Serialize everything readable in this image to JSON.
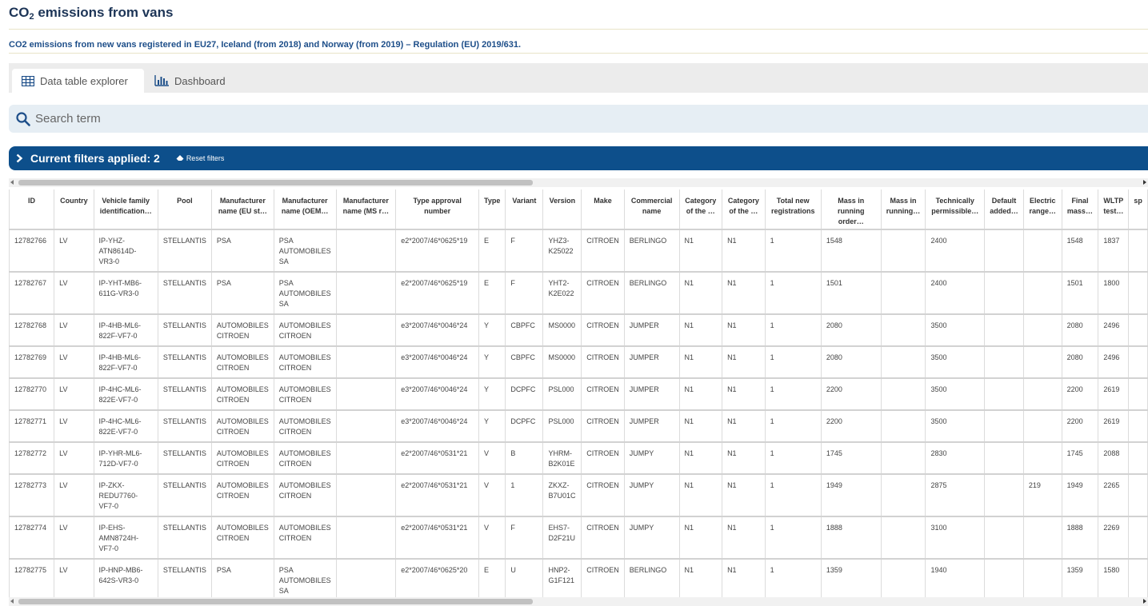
{
  "header": {
    "title_prefix": "CO",
    "title_sub": "2",
    "title_suffix": " emissions from vans",
    "subtitle": "CO2 emissions from new vans registered in EU27, Iceland (from 2018) and Norway (from 2019) – Regulation (EU) 2019/631."
  },
  "tabs": [
    {
      "label": "Data table explorer",
      "icon": "table-grid-icon",
      "active": true
    },
    {
      "label": "Dashboard",
      "icon": "bar-chart-icon",
      "active": false
    }
  ],
  "search": {
    "placeholder": "Search term"
  },
  "filters": {
    "label": "Current filters applied: 2",
    "reset_label": "Reset filters"
  },
  "colors": {
    "primary": "#0d4f8b",
    "search_bg": "#e6eef4",
    "tabbar_bg": "#ececec",
    "title": "#1d3557"
  },
  "table": {
    "columns": [
      "ID",
      "Country",
      "Vehicle family identification…",
      "Pool",
      "Manufacturer name (EU st…",
      "Manufacturer name (OEM…",
      "Manufacturer name (MS r…",
      "Type approval number",
      "Type",
      "Variant",
      "Version",
      "Make",
      "Commercial name",
      "Category of the …",
      "Category of the …",
      "Total new registrations",
      "Mass in running order…",
      "Mass in running…",
      "Technically permissible…",
      "Default added…",
      "Electric range…",
      "Final mass…",
      "WLTP test…",
      "sp"
    ],
    "rows": [
      [
        "12782766",
        "LV",
        "IP-YHZ-ATN8614D-VR3-0",
        "STELLANTIS",
        "PSA",
        "PSA AUTOMOBILES SA",
        "",
        "e2*2007/46*0625*19",
        "E",
        "F",
        "YHZ3-K25022",
        "CITROEN",
        "BERLINGO",
        "N1",
        "N1",
        "1",
        "1548",
        "",
        "2400",
        "",
        "",
        "1548",
        "1837",
        ""
      ],
      [
        "12782767",
        "LV",
        "IP-YHT-MB6-611G-VR3-0",
        "STELLANTIS",
        "PSA",
        "PSA AUTOMOBILES SA",
        "",
        "e2*2007/46*0625*19",
        "E",
        "F",
        "YHT2-K2E022",
        "CITROEN",
        "BERLINGO",
        "N1",
        "N1",
        "1",
        "1501",
        "",
        "2400",
        "",
        "",
        "1501",
        "1800",
        ""
      ],
      [
        "12782768",
        "LV",
        "IP-4HB-ML6-822F-VF7-0",
        "STELLANTIS",
        "AUTOMOBILES CITROEN",
        "AUTOMOBILES CITROEN",
        "",
        "e3*2007/46*0046*24",
        "Y",
        "CBPFC",
        "MS0000",
        "CITROEN",
        "JUMPER",
        "N1",
        "N1",
        "1",
        "2080",
        "",
        "3500",
        "",
        "",
        "2080",
        "2496",
        ""
      ],
      [
        "12782769",
        "LV",
        "IP-4HB-ML6-822F-VF7-0",
        "STELLANTIS",
        "AUTOMOBILES CITROEN",
        "AUTOMOBILES CITROEN",
        "",
        "e3*2007/46*0046*24",
        "Y",
        "CBPFC",
        "MS0000",
        "CITROEN",
        "JUMPER",
        "N1",
        "N1",
        "1",
        "2080",
        "",
        "3500",
        "",
        "",
        "2080",
        "2496",
        ""
      ],
      [
        "12782770",
        "LV",
        "IP-4HC-ML6-822E-VF7-0",
        "STELLANTIS",
        "AUTOMOBILES CITROEN",
        "AUTOMOBILES CITROEN",
        "",
        "e3*2007/46*0046*24",
        "Y",
        "DCPFC",
        "PSL000",
        "CITROEN",
        "JUMPER",
        "N1",
        "N1",
        "1",
        "2200",
        "",
        "3500",
        "",
        "",
        "2200",
        "2619",
        ""
      ],
      [
        "12782771",
        "LV",
        "IP-4HC-ML6-822E-VF7-0",
        "STELLANTIS",
        "AUTOMOBILES CITROEN",
        "AUTOMOBILES CITROEN",
        "",
        "e3*2007/46*0046*24",
        "Y",
        "DCPFC",
        "PSL000",
        "CITROEN",
        "JUMPER",
        "N1",
        "N1",
        "1",
        "2200",
        "",
        "3500",
        "",
        "",
        "2200",
        "2619",
        ""
      ],
      [
        "12782772",
        "LV",
        "IP-YHR-ML6-712D-VF7-0",
        "STELLANTIS",
        "AUTOMOBILES CITROEN",
        "AUTOMOBILES CITROEN",
        "",
        "e2*2007/46*0531*21",
        "V",
        "B",
        "YHRM-B2K01E",
        "CITROEN",
        "JUMPY",
        "N1",
        "N1",
        "1",
        "1745",
        "",
        "2830",
        "",
        "",
        "1745",
        "2088",
        ""
      ],
      [
        "12782773",
        "LV",
        "IP-ZKX-REDU7760-VF7-0",
        "STELLANTIS",
        "AUTOMOBILES CITROEN",
        "AUTOMOBILES CITROEN",
        "",
        "e2*2007/46*0531*21",
        "V",
        "1",
        "ZKXZ-B7U01C",
        "CITROEN",
        "JUMPY",
        "N1",
        "N1",
        "1",
        "1949",
        "",
        "2875",
        "",
        "219",
        "1949",
        "2265",
        ""
      ],
      [
        "12782774",
        "LV",
        "IP-EHS-AMN8724H-VF7-0",
        "STELLANTIS",
        "AUTOMOBILES CITROEN",
        "AUTOMOBILES CITROEN",
        "",
        "e2*2007/46*0531*21",
        "V",
        "F",
        "EHS7-D2F21U",
        "CITROEN",
        "JUMPY",
        "N1",
        "N1",
        "1",
        "1888",
        "",
        "3100",
        "",
        "",
        "1888",
        "2269",
        ""
      ],
      [
        "12782775",
        "LV",
        "IP-HNP-MB6-642S-VR3-0",
        "STELLANTIS",
        "PSA",
        "PSA AUTOMOBILES SA",
        "",
        "e2*2007/46*0625*20",
        "E",
        "U",
        "HNP2-G1F121",
        "CITROEN",
        "BERLINGO",
        "N1",
        "N1",
        "1",
        "1359",
        "",
        "1940",
        "",
        "",
        "1359",
        "1580",
        ""
      ]
    ]
  }
}
